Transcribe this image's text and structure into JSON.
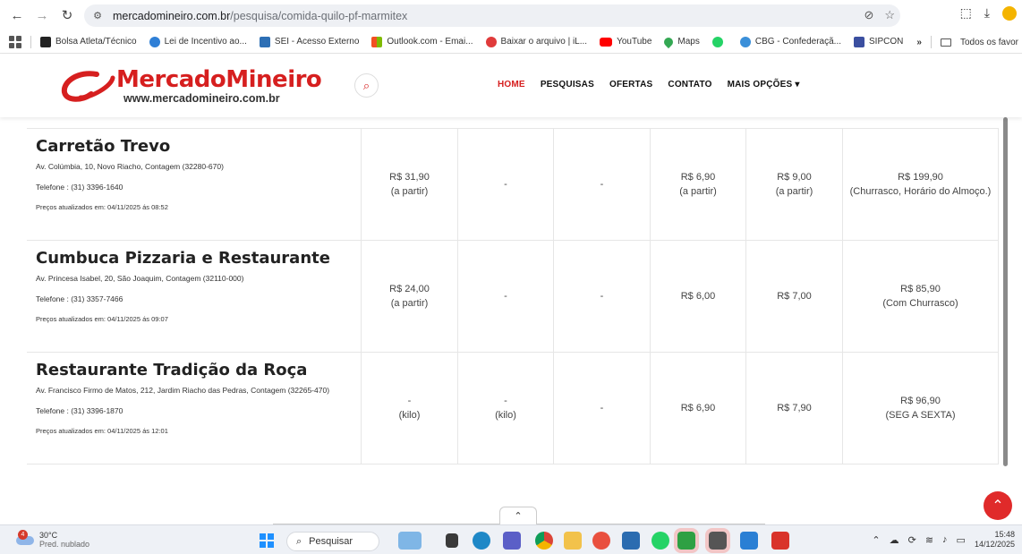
{
  "browser": {
    "url_host": "mercadomineiro.com.br",
    "url_path": "/pesquisa/comida-quilo-pf-marmitex",
    "bookmarks": [
      {
        "label": "Bolsa Atleta/Técnico",
        "color": "#222222"
      },
      {
        "label": "Lei de Incentivo ao...",
        "color": "#2f7fd6"
      },
      {
        "label": "SEI - Acesso Externo",
        "color": "#2d6fb5"
      },
      {
        "label": "Outlook.com - Emai...",
        "color": "#f2a51a"
      },
      {
        "label": "Baixar o arquivo | iL...",
        "color": "#e03b3b"
      },
      {
        "label": "YouTube",
        "color": "#ff0000"
      },
      {
        "label": "Maps",
        "color": "#34a853"
      },
      {
        "label": "",
        "color": "#25d366"
      },
      {
        "label": "CBG - Confederaçã...",
        "color": "#3a8fd9"
      },
      {
        "label": "SIPCON",
        "color": "#3b4fa0"
      }
    ],
    "bookmarks_more": "»",
    "all_bookmarks": "Todos os favor"
  },
  "site": {
    "logo_name": "MercadoMineiro",
    "logo_url": "www.mercadomineiro.com.br",
    "brand_color": "#d61f1f",
    "menu": [
      {
        "label": "HOME",
        "active": true
      },
      {
        "label": "PESQUISAS",
        "active": false
      },
      {
        "label": "OFERTAS",
        "active": false
      },
      {
        "label": "CONTATO",
        "active": false
      },
      {
        "label": "MAIS OPÇÕES ▾",
        "active": false
      }
    ]
  },
  "restaurants": [
    {
      "name": "Carretão Trevo",
      "address": "Av. Colúmbia, 10, Novo Riacho, Contagem (32280-670)",
      "phone": "Telefone : (31) 3396-1640",
      "updated": "Preços atualizados em: 04/11/2025 ás 08:52",
      "cells": [
        {
          "line1": "R$ 31,90",
          "line2": "(a partir)"
        },
        {
          "line1": "-",
          "line2": ""
        },
        {
          "line1": "-",
          "line2": ""
        },
        {
          "line1": "R$ 6,90",
          "line2": "(a partir)"
        },
        {
          "line1": "R$ 9,00",
          "line2": "(a partir)"
        },
        {
          "line1": "R$ 199,90",
          "line2": "(Churrasco, Horário do Almoço.)"
        }
      ]
    },
    {
      "name": "Cumbuca Pizzaria e Restaurante",
      "address": "Av. Princesa Isabel, 20, São Joaquim, Contagem (32110-000)",
      "phone": "Telefone : (31) 3357-7466",
      "updated": "Preços atualizados em: 04/11/2025 ás 09:07",
      "cells": [
        {
          "line1": "R$ 24,00",
          "line2": "(a partir)"
        },
        {
          "line1": "-",
          "line2": ""
        },
        {
          "line1": "-",
          "line2": ""
        },
        {
          "line1": "R$ 6,00",
          "line2": ""
        },
        {
          "line1": "R$ 7,00",
          "line2": ""
        },
        {
          "line1": "R$ 85,90",
          "line2": "(Com Churrasco)"
        }
      ]
    },
    {
      "name": "Restaurante Tradição da Roça",
      "address": "Av. Francisco Firmo de Matos, 212, Jardim Riacho das Pedras, Contagem (32265-470)",
      "phone": "Telefone : (31) 3396-1870",
      "updated": "Preços atualizados em: 04/11/2025 ás 12:01",
      "cells": [
        {
          "line1": "-",
          "line2": "(kilo)"
        },
        {
          "line1": "-",
          "line2": "(kilo)"
        },
        {
          "line1": "-",
          "line2": ""
        },
        {
          "line1": "R$ 6,90",
          "line2": ""
        },
        {
          "line1": "R$ 7,90",
          "line2": ""
        },
        {
          "line1": "R$ 96,90",
          "line2": "(SEG A SEXTA)"
        }
      ]
    }
  ],
  "taskbar": {
    "weather_badge": "4",
    "temperature": "30°C",
    "condition": "Pred. nublado",
    "search_placeholder": "Pesquisar",
    "time": "15:48",
    "date": "14/12/2025"
  }
}
